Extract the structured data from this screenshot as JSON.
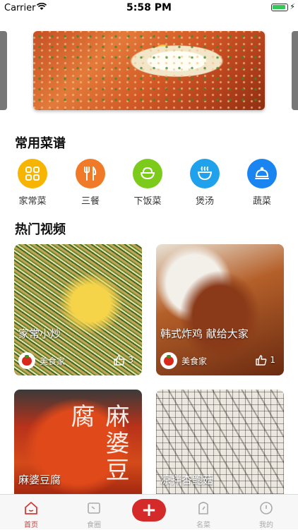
{
  "status": {
    "carrier": "Carrier",
    "time": "5:58 PM"
  },
  "sections": {
    "common_recipes": "常用菜谱",
    "hot_videos": "热门视频"
  },
  "categories": [
    {
      "label": "家常菜",
      "icon": "grid-icon",
      "color": "#f7b400"
    },
    {
      "label": "三餐",
      "icon": "fork-knife-icon",
      "color": "#f07a28"
    },
    {
      "label": "下饭菜",
      "icon": "rice-bowl-icon",
      "color": "#7ccb1b"
    },
    {
      "label": "煲汤",
      "icon": "soup-bowl-icon",
      "color": "#1fa1ec"
    },
    {
      "label": "蔬菜",
      "icon": "cloche-icon",
      "color": "#1a84f0"
    }
  ],
  "videos": [
    {
      "title": "家常小炒",
      "author": "美食家",
      "likes": "3"
    },
    {
      "title": "韩式炸鸡 献给大家",
      "author": "美食家",
      "likes": "1"
    },
    {
      "title": "麻婆豆腐",
      "overlay": "麻婆豆腐"
    },
    {
      "title": "凉拌杏鲍菇"
    }
  ],
  "tabs": [
    {
      "label": "首页",
      "icon": "home-icon",
      "active": true
    },
    {
      "label": "食圈",
      "icon": "circle-feed-icon",
      "active": false
    },
    {
      "label": "",
      "icon": "plus-icon",
      "active": false
    },
    {
      "label": "名菜",
      "icon": "tag-icon",
      "active": false
    },
    {
      "label": "我的",
      "icon": "profile-icon",
      "active": false
    }
  ],
  "add_button": {
    "symbol": "+"
  },
  "colors": {
    "accent": "#d23b33",
    "tab_inactive": "#aaaaaa"
  }
}
